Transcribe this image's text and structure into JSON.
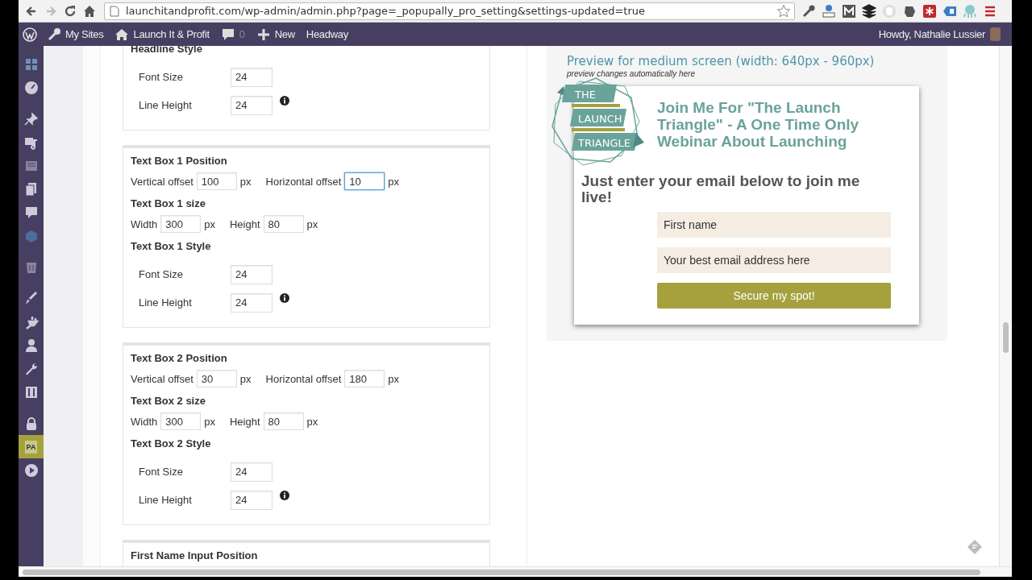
{
  "browser": {
    "url": "launchitandprofit.com/wp-admin/admin.php?page=_popupally_pro_setting&settings-updated=true"
  },
  "admin_bar": {
    "items": [
      {
        "kind": "logo"
      },
      {
        "kind": "sites",
        "label": "My Sites"
      },
      {
        "kind": "site",
        "label": "Launch It & Profit"
      },
      {
        "kind": "comments",
        "label": "0"
      },
      {
        "kind": "new",
        "label": "New"
      },
      {
        "kind": "plain",
        "label": "Headway"
      }
    ],
    "greeting": "Howdy, Nathalie Lussier"
  },
  "sidebar": {
    "items": [
      {
        "selected": false
      },
      {
        "selected": false
      },
      {
        "selected": false
      },
      {
        "selected": false
      },
      {
        "selected": false
      },
      {
        "selected": false
      },
      {
        "selected": false
      },
      {
        "selected": false
      },
      {
        "selected": false
      },
      {
        "selected": false
      },
      {
        "selected": false
      },
      {
        "selected": false
      },
      {
        "selected": false
      },
      {
        "selected": false
      },
      {
        "selected": false
      },
      {
        "label": "PA",
        "selected": true
      },
      {
        "selected": false
      }
    ]
  },
  "settings": {
    "boxes": [
      {
        "items": [
          {
            "kind": "heading",
            "text": "Headline Style"
          },
          {
            "kind": "style",
            "label": "Font Size",
            "value": "24",
            "info": false
          },
          {
            "kind": "style",
            "label": "Line Height",
            "value": "24",
            "info": true
          }
        ]
      },
      {
        "items": [
          {
            "kind": "heading",
            "text": "Text Box 1 Position"
          },
          {
            "kind": "pair",
            "fields": [
              {
                "label": "Vertical offset",
                "value": "100",
                "unit": "px",
                "focused": false
              },
              {
                "label": "Horizontal offset",
                "value": "10",
                "unit": "px",
                "focused": true
              }
            ]
          },
          {
            "kind": "heading",
            "text": "Text Box 1 size"
          },
          {
            "kind": "pair",
            "fields": [
              {
                "label": "Width",
                "value": "300",
                "unit": "px",
                "focused": false
              },
              {
                "label": "Height",
                "value": "80",
                "unit": "px",
                "focused": false
              }
            ]
          },
          {
            "kind": "heading",
            "text": "Text Box 1 Style"
          },
          {
            "kind": "style",
            "label": "Font Size",
            "value": "24",
            "info": false
          },
          {
            "kind": "style",
            "label": "Line Height",
            "value": "24",
            "info": true
          }
        ]
      },
      {
        "items": [
          {
            "kind": "heading",
            "text": "Text Box 2 Position"
          },
          {
            "kind": "pair",
            "fields": [
              {
                "label": "Vertical offset",
                "value": "30",
                "unit": "px",
                "focused": false
              },
              {
                "label": "Horizontal offset",
                "value": "180",
                "unit": "px",
                "focused": false
              }
            ]
          },
          {
            "kind": "heading",
            "text": "Text Box 2 size"
          },
          {
            "kind": "pair",
            "fields": [
              {
                "label": "Width",
                "value": "300",
                "unit": "px",
                "focused": false
              },
              {
                "label": "Height",
                "value": "80",
                "unit": "px",
                "focused": false
              }
            ]
          },
          {
            "kind": "heading",
            "text": "Text Box 2 Style"
          },
          {
            "kind": "style",
            "label": "Font Size",
            "value": "24",
            "info": false
          },
          {
            "kind": "style",
            "label": "Line Height",
            "value": "24",
            "info": true
          }
        ]
      },
      {
        "items": [
          {
            "kind": "heading",
            "text": "First Name Input Position"
          }
        ]
      }
    ]
  },
  "preview": {
    "title": "Preview for medium screen (width: 640px - 960px)",
    "subtitle": "preview changes automatically here",
    "logo_words": [
      "THE",
      "LAUNCH",
      "TRIANGLE"
    ],
    "headline": "Join Me For \"The Launch Triangle\" - A One Time Only Webinar About Launching",
    "body": "Just enter your email below to join me live!",
    "first_name_placeholder": "First name",
    "email_placeholder": "Your best email address here",
    "button": "Secure my spot!"
  }
}
